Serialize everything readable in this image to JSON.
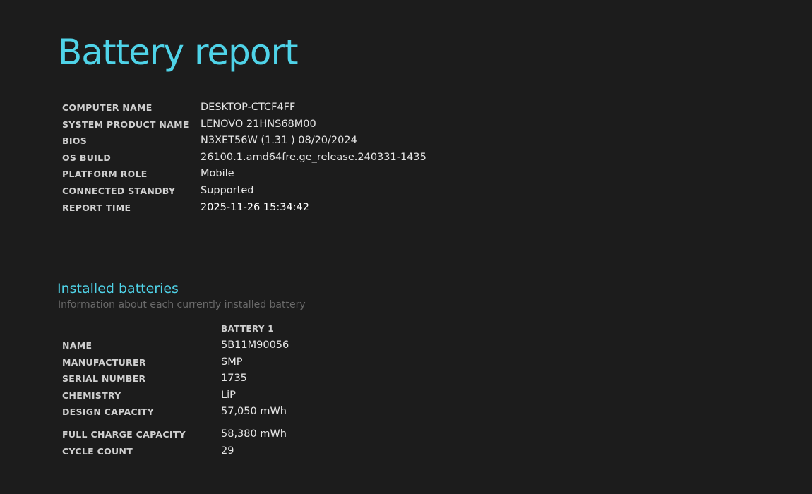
{
  "title": "Battery report",
  "system_info": [
    {
      "label": "COMPUTER NAME",
      "value": "DESKTOP-CTCF4FF"
    },
    {
      "label": "SYSTEM PRODUCT NAME",
      "value": "LENOVO 21HNS68M00"
    },
    {
      "label": "BIOS",
      "value": "N3XET56W (1.31 ) 08/20/2024"
    },
    {
      "label": "OS BUILD",
      "value": "26100.1.amd64fre.ge_release.240331-1435"
    },
    {
      "label": "PLATFORM ROLE",
      "value": "Mobile"
    },
    {
      "label": "CONNECTED STANDBY",
      "value": "Supported"
    },
    {
      "label": "REPORT TIME",
      "value": "2025-11-26  15:34:42"
    }
  ],
  "installed_batteries": {
    "title": "Installed batteries",
    "subtitle": "Information about each currently installed battery",
    "column_header": "BATTERY 1",
    "rows": [
      {
        "label": "NAME",
        "value": "5B11M90056"
      },
      {
        "label": "MANUFACTURER",
        "value": "SMP"
      },
      {
        "label": "SERIAL NUMBER",
        "value": "1735"
      },
      {
        "label": "CHEMISTRY",
        "value": "LiP"
      },
      {
        "label": "DESIGN CAPACITY",
        "value": "57,050 mWh"
      },
      {
        "label": "FULL CHARGE CAPACITY",
        "value": "58,380 mWh"
      },
      {
        "label": "CYCLE COUNT",
        "value": "29"
      }
    ]
  },
  "colors": {
    "background": "#1c1c1c",
    "accent": "#4fd3e8",
    "label": "#cfcfcf",
    "value": "#e6e6e6",
    "muted": "#6a6a6a"
  }
}
